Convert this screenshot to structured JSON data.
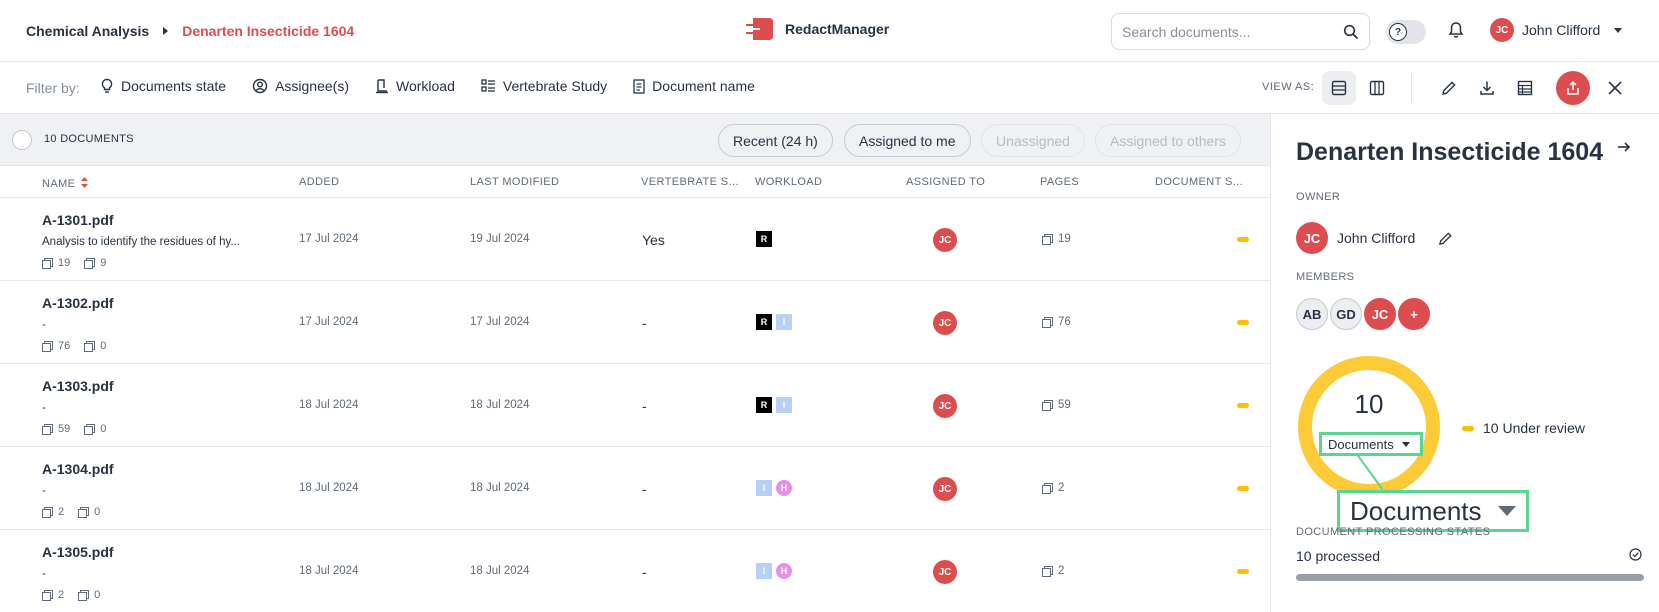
{
  "breadcrumb": {
    "parent": "Chemical Analysis",
    "current": "Denarten Insecticide 1604"
  },
  "app": {
    "name": "RedactManager"
  },
  "search": {
    "placeholder": "Search documents..."
  },
  "user": {
    "initials": "JC",
    "name": "John Clifford"
  },
  "filterbar": {
    "label": "Filter by:",
    "filters": [
      {
        "label": "Documents state",
        "icon": "lightbulb-icon"
      },
      {
        "label": "Assignee(s)",
        "icon": "user-circle-icon"
      },
      {
        "label": "Workload",
        "icon": "workload-icon"
      },
      {
        "label": "Vertebrate Study",
        "icon": "list-icon"
      },
      {
        "label": "Document name",
        "icon": "document-icon"
      }
    ],
    "view_as_label": "VIEW AS:"
  },
  "table": {
    "count_label": "10 DOCUMENTS",
    "chips": [
      "Recent (24 h)",
      "Assigned to me",
      "Unassigned",
      "Assigned to others"
    ],
    "columns": [
      "NAME",
      "ADDED",
      "LAST MODIFIED",
      "VERTEBRATE S...",
      "WORKLOAD",
      "ASSIGNED TO",
      "PAGES",
      "DOCUMENT S..."
    ],
    "rows": [
      {
        "name": "A-1301.pdf",
        "desc": "Analysis to identify the residues of hy...",
        "meta_pages": "19",
        "meta_files": "9",
        "added": "17 Jul 2024",
        "modified": "19 Jul 2024",
        "vertebrate": "Yes",
        "workload": [
          "R"
        ],
        "assignee": "JC",
        "pages": "19"
      },
      {
        "name": "A-1302.pdf",
        "desc": "-",
        "meta_pages": "76",
        "meta_files": "0",
        "added": "17 Jul 2024",
        "modified": "17 Jul 2024",
        "vertebrate": "-",
        "workload": [
          "R",
          "I"
        ],
        "assignee": "JC",
        "pages": "76"
      },
      {
        "name": "A-1303.pdf",
        "desc": "-",
        "meta_pages": "59",
        "meta_files": "0",
        "added": "18 Jul 2024",
        "modified": "18 Jul 2024",
        "vertebrate": "-",
        "workload": [
          "R",
          "I"
        ],
        "assignee": "JC",
        "pages": "59"
      },
      {
        "name": "A-1304.pdf",
        "desc": "-",
        "meta_pages": "2",
        "meta_files": "0",
        "added": "18 Jul 2024",
        "modified": "18 Jul 2024",
        "vertebrate": "-",
        "workload": [
          "I",
          "H"
        ],
        "assignee": "JC",
        "pages": "2"
      },
      {
        "name": "A-1305.pdf",
        "desc": "-",
        "meta_pages": "2",
        "meta_files": "0",
        "added": "18 Jul 2024",
        "modified": "18 Jul 2024",
        "vertebrate": "-",
        "workload": [
          "I",
          "H"
        ],
        "assignee": "JC",
        "pages": "2"
      }
    ]
  },
  "panel": {
    "title": "Denarten Insecticide 1604",
    "owner_label": "OWNER",
    "owner": {
      "initials": "JC",
      "name": "John Clifford"
    },
    "members_label": "MEMBERS",
    "members": [
      "AB",
      "GD",
      "JC",
      "+"
    ],
    "donut_total": "10",
    "donut_select": "Documents",
    "legend": "10 Under review",
    "zoom_text": "Documents",
    "processing_label": "DOCUMENT PROCESSING STATES",
    "processing_text": "10 processed"
  },
  "colors": {
    "accent": "#dd4d50",
    "under_review": "#fdbd00",
    "highlight": "#5bd68e"
  }
}
